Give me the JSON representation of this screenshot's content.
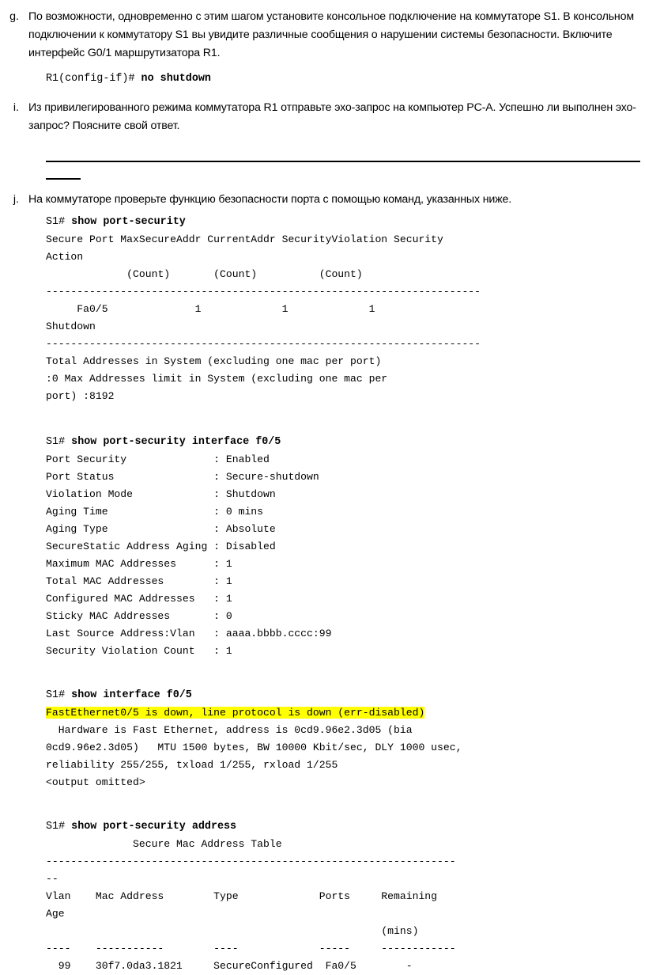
{
  "items": {
    "g": {
      "marker": "g.",
      "text": "По возможности, одновременно с этим шагом установите консольное подключение на коммутаторе S1. В консольном подключении к коммутатору S1 вы увидите различные сообщения о нарушении системы безопасности. Включите интерфейс G0/1 маршрутизатора R1."
    },
    "i": {
      "marker": "i.",
      "text": "Из привилегированного режима коммутатора R1 отправьте эхо-запрос на компьютер PC-A. Успешно ли выполнен эхо-запрос? Поясните свой ответ."
    },
    "j": {
      "marker": "j.",
      "text": "На коммутаторе проверьте функцию безопасности порта с помощью команд, указанных ниже."
    }
  },
  "commands": {
    "no_shutdown": {
      "prompt": "R1(config-if)# ",
      "cmd": "no shutdown"
    },
    "show_port_security": {
      "prompt": "S1# ",
      "cmd": "show port-security"
    },
    "show_port_security_interface": {
      "prompt": "S1# ",
      "cmd": "show port-security interface f0/5"
    },
    "show_interface": {
      "prompt": "S1# ",
      "cmd": "show interface f0/5"
    },
    "show_port_security_address": {
      "prompt": "S1# ",
      "cmd": "show port-security address"
    }
  },
  "outputs": {
    "port_security_table": "Secure Port MaxSecureAddr CurrentAddr SecurityViolation Security\nAction\n             (Count)       (Count)          (Count)\n----------------------------------------------------------------------\n     Fa0/5              1             1             1\nShutdown\n----------------------------------------------------------------------\nTotal Addresses in System (excluding one mac per port)\n:0 Max Addresses limit in System (excluding one mac per\nport) :8192",
    "port_security_interface": "Port Security              : Enabled\nPort Status                : Secure-shutdown\nViolation Mode             : Shutdown\nAging Time                 : 0 mins\nAging Type                 : Absolute\nSecureStatic Address Aging : Disabled\nMaximum MAC Addresses      : 1\nTotal MAC Addresses        : 1\nConfigured MAC Addresses   : 1\nSticky MAC Addresses       : 0\nLast Source Address:Vlan   : aaaa.bbbb.cccc:99\nSecurity Violation Count   : 1",
    "interface_highlight": "FastEthernet0/5 is down, line protocol is down (err-disabled)",
    "interface_rest": "  Hardware is Fast Ethernet, address is 0cd9.96e2.3d05 (bia\n0cd9.96e2.3d05)   MTU 1500 bytes, BW 10000 Kbit/sec, DLY 1000 usec,\nreliability 255/255, txload 1/255, rxload 1/255\n<output omitted>",
    "secure_mac_table": "              Secure Mac Address Table\n------------------------------------------------------------------\n--\nVlan    Mac Address        Type             Ports     Remaining\nAge\n                                                      (mins)\n----    -----------        ----             -----     ------------\n  99    30f7.0da3.1821     SecureConfigured  Fa0/5        -"
  },
  "colors": {
    "highlight": "#ffff00",
    "text": "#000000",
    "rule": "#000000"
  }
}
